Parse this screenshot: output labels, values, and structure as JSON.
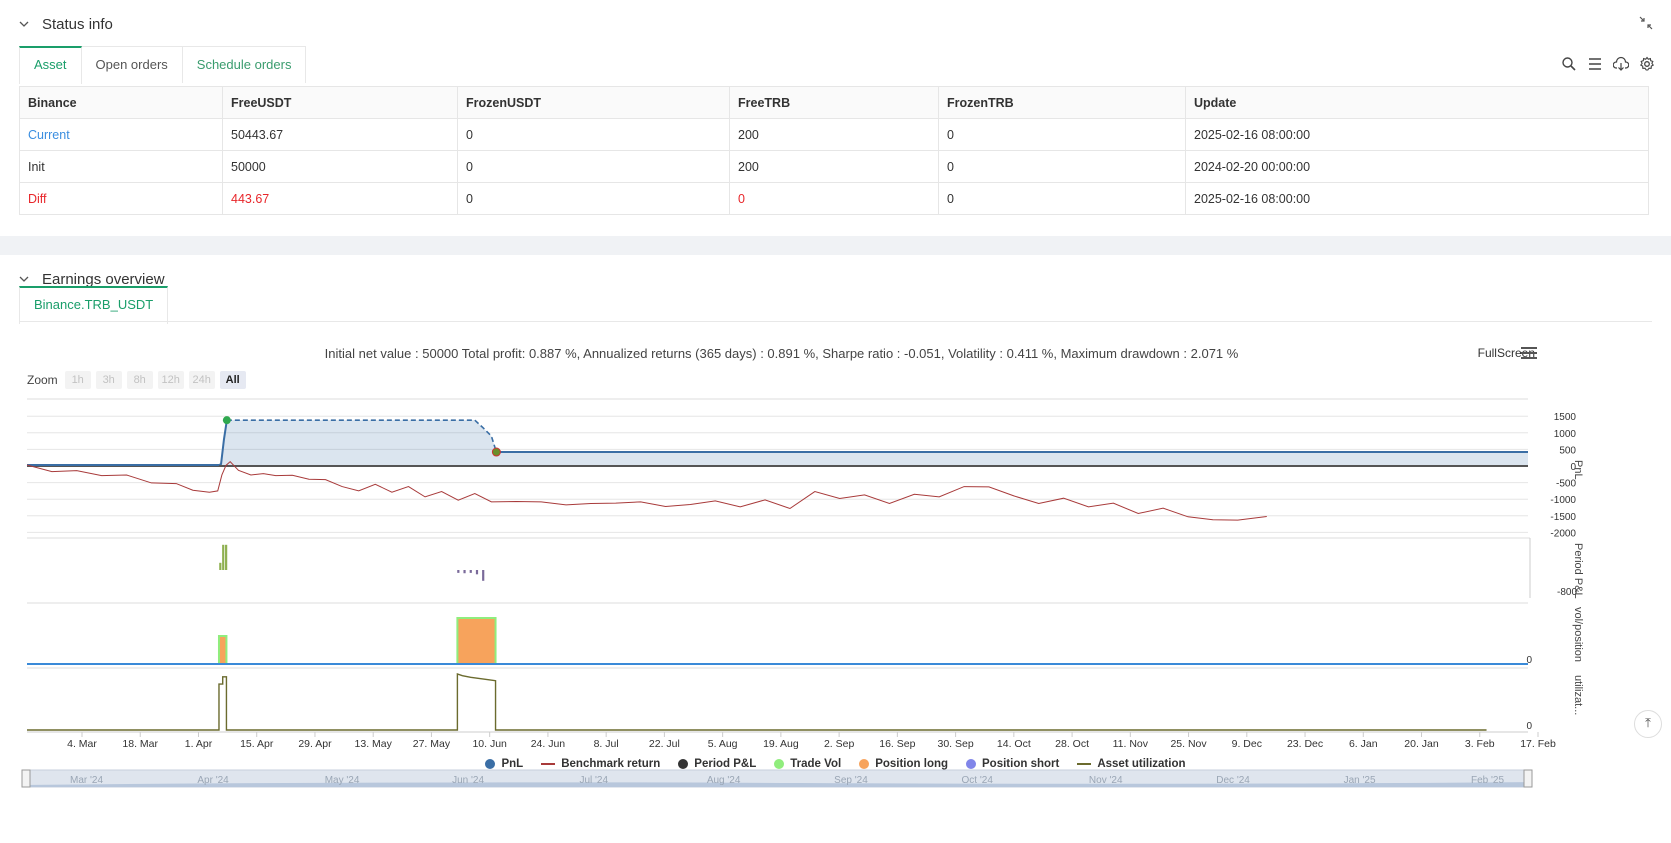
{
  "status": {
    "title": "Status info",
    "tabs": [
      "Asset",
      "Open orders",
      "Schedule orders"
    ],
    "table": {
      "headers": [
        "Binance",
        "FreeUSDT",
        "FrozenUSDT",
        "FreeTRB",
        "FrozenTRB",
        "Update"
      ],
      "rows": [
        [
          "Current",
          "50443.67",
          "0",
          "200",
          "0",
          "2025-02-16 08:00:00"
        ],
        [
          "Init",
          "50000",
          "0",
          "200",
          "0",
          "2024-02-20 00:00:00"
        ],
        [
          "Diff",
          "443.67",
          "0",
          "0",
          "0",
          "2025-02-16 08:00:00"
        ]
      ]
    }
  },
  "earnings": {
    "title": "Earnings overview",
    "tab": "Binance.TRB_USDT",
    "summary": "Initial net value : 50000 Total profit: 0.887 %, Annualized returns (365 days) : 0.891 %, Sharpe ratio : -0.051, Volatility : 0.411 %, Maximum drawdown : 2.071 %",
    "fullscreen": "FullScreen",
    "zoom_label": "Zoom",
    "zoom_buttons": [
      "1h",
      "3h",
      "8h",
      "12h",
      "24h",
      "All"
    ],
    "legend": [
      "PnL",
      "Benchmark return",
      "Period P&L",
      "Trade Vol",
      "Position long",
      "Position short",
      "Asset utilization"
    ]
  },
  "colors": {
    "pnl": "#3a6ea5",
    "benchmark": "#a83a3a",
    "period_pnl": "#333333",
    "trade_vol": "#90ed7d",
    "position_long": "#f7a35c",
    "position_short": "#8085e9",
    "asset_util": "#6b6b2e",
    "accent": "#1a9e6a"
  },
  "chart_data": {
    "type": "line",
    "x_ticks": [
      "4. Mar",
      "18. Mar",
      "1. Apr",
      "15. Apr",
      "29. Apr",
      "13. May",
      "27. May",
      "10. Jun",
      "24. Jun",
      "8. Jul",
      "22. Jul",
      "5. Aug",
      "19. Aug",
      "2. Sep",
      "16. Sep",
      "30. Sep",
      "14. Oct",
      "28. Oct",
      "11. Nov",
      "25. Nov",
      "9. Dec",
      "23. Dec",
      "6. Jan",
      "20. Jan",
      "3. Feb",
      "17. Feb"
    ],
    "navigator_ticks": [
      "Mar '24",
      "Apr '24",
      "May '24",
      "Jun '24",
      "Jul '24",
      "Aug '24",
      "Sep '24",
      "Oct '24",
      "Nov '24",
      "Dec '24",
      "Jan '25",
      "Feb '25"
    ],
    "pnl_axis": {
      "label": "PnL",
      "ticks": [
        1500,
        1000,
        500,
        0,
        -500,
        -1000,
        -1500,
        -2000
      ]
    },
    "period_axis": {
      "label": "Period P&L",
      "ticks": [
        -800
      ]
    },
    "vol_axis": {
      "label": "vol/position",
      "ticks": [
        0
      ]
    },
    "util_axis": {
      "label": "utilizat...",
      "ticks": [
        0
      ]
    },
    "pnl_series": [
      [
        0,
        0
      ],
      [
        46,
        0
      ],
      [
        46.8,
        60
      ],
      [
        47.5,
        800
      ],
      [
        48.2,
        1380
      ],
      [
        99.6,
        1380
      ],
      [
        99.6,
        1380
      ],
      [
        108,
        1380
      ],
      [
        110,
        1150
      ],
      [
        112,
        900
      ],
      [
        113.2,
        420
      ],
      [
        352,
        420
      ]
    ],
    "benchmark_series": [
      [
        0,
        0
      ],
      [
        6,
        -140
      ],
      [
        12,
        -170
      ],
      [
        18,
        -260
      ],
      [
        24,
        -300
      ],
      [
        30,
        -480
      ],
      [
        36,
        -560
      ],
      [
        40,
        -700
      ],
      [
        44,
        -820
      ],
      [
        46,
        -720
      ],
      [
        47,
        -300
      ],
      [
        48,
        50
      ],
      [
        49,
        100
      ],
      [
        51,
        -100
      ],
      [
        54,
        -300
      ],
      [
        57,
        -200
      ],
      [
        60,
        -320
      ],
      [
        64,
        -250
      ],
      [
        68,
        -430
      ],
      [
        72,
        -380
      ],
      [
        76,
        -650
      ],
      [
        80,
        -720
      ],
      [
        84,
        -580
      ],
      [
        88,
        -760
      ],
      [
        92,
        -650
      ],
      [
        96,
        -900
      ],
      [
        100,
        -800
      ],
      [
        104,
        -1000
      ],
      [
        108,
        -860
      ],
      [
        112,
        -1050
      ],
      [
        118,
        -1100
      ],
      [
        124,
        -1050
      ],
      [
        130,
        -1200
      ],
      [
        136,
        -1100
      ],
      [
        142,
        -1150
      ],
      [
        148,
        -1050
      ],
      [
        154,
        -1250
      ],
      [
        160,
        -1130
      ],
      [
        166,
        -1080
      ],
      [
        172,
        -1200
      ],
      [
        178,
        -1050
      ],
      [
        184,
        -1250
      ],
      [
        190,
        -800
      ],
      [
        196,
        -950
      ],
      [
        202,
        -900
      ],
      [
        208,
        -1100
      ],
      [
        214,
        -880
      ],
      [
        220,
        -900
      ],
      [
        226,
        -650
      ],
      [
        232,
        -600
      ],
      [
        238,
        -930
      ],
      [
        244,
        -1100
      ],
      [
        250,
        -1000
      ],
      [
        256,
        -1200
      ],
      [
        262,
        -1150
      ],
      [
        268,
        -1400
      ],
      [
        274,
        -1300
      ],
      [
        280,
        -1500
      ],
      [
        286,
        -1650
      ],
      [
        292,
        -1600
      ],
      [
        299,
        -1550
      ]
    ],
    "period_pnl_bars": [
      [
        46.6,
        200
      ],
      [
        47.3,
        700
      ],
      [
        48,
        700
      ],
      [
        104,
        -80
      ],
      [
        105.5,
        -90
      ],
      [
        107,
        -80
      ],
      [
        108.5,
        -120
      ],
      [
        110,
        -300
      ]
    ],
    "position_long_blocks": [
      [
        46.3,
        48.1
      ],
      [
        103.8,
        113
      ]
    ],
    "asset_util_series": [
      [
        0,
        0
      ],
      [
        46.3,
        0
      ],
      [
        46.3,
        0.82
      ],
      [
        47.2,
        0.82
      ],
      [
        47.2,
        0.95
      ],
      [
        48.1,
        0.95
      ],
      [
        48.1,
        0
      ],
      [
        103.8,
        0
      ],
      [
        103.8,
        1
      ],
      [
        105,
        0.97
      ],
      [
        107,
        0.94
      ],
      [
        109,
        0.92
      ],
      [
        111,
        0.9
      ],
      [
        113,
        0.88
      ],
      [
        113,
        0
      ],
      [
        352,
        0
      ]
    ]
  }
}
